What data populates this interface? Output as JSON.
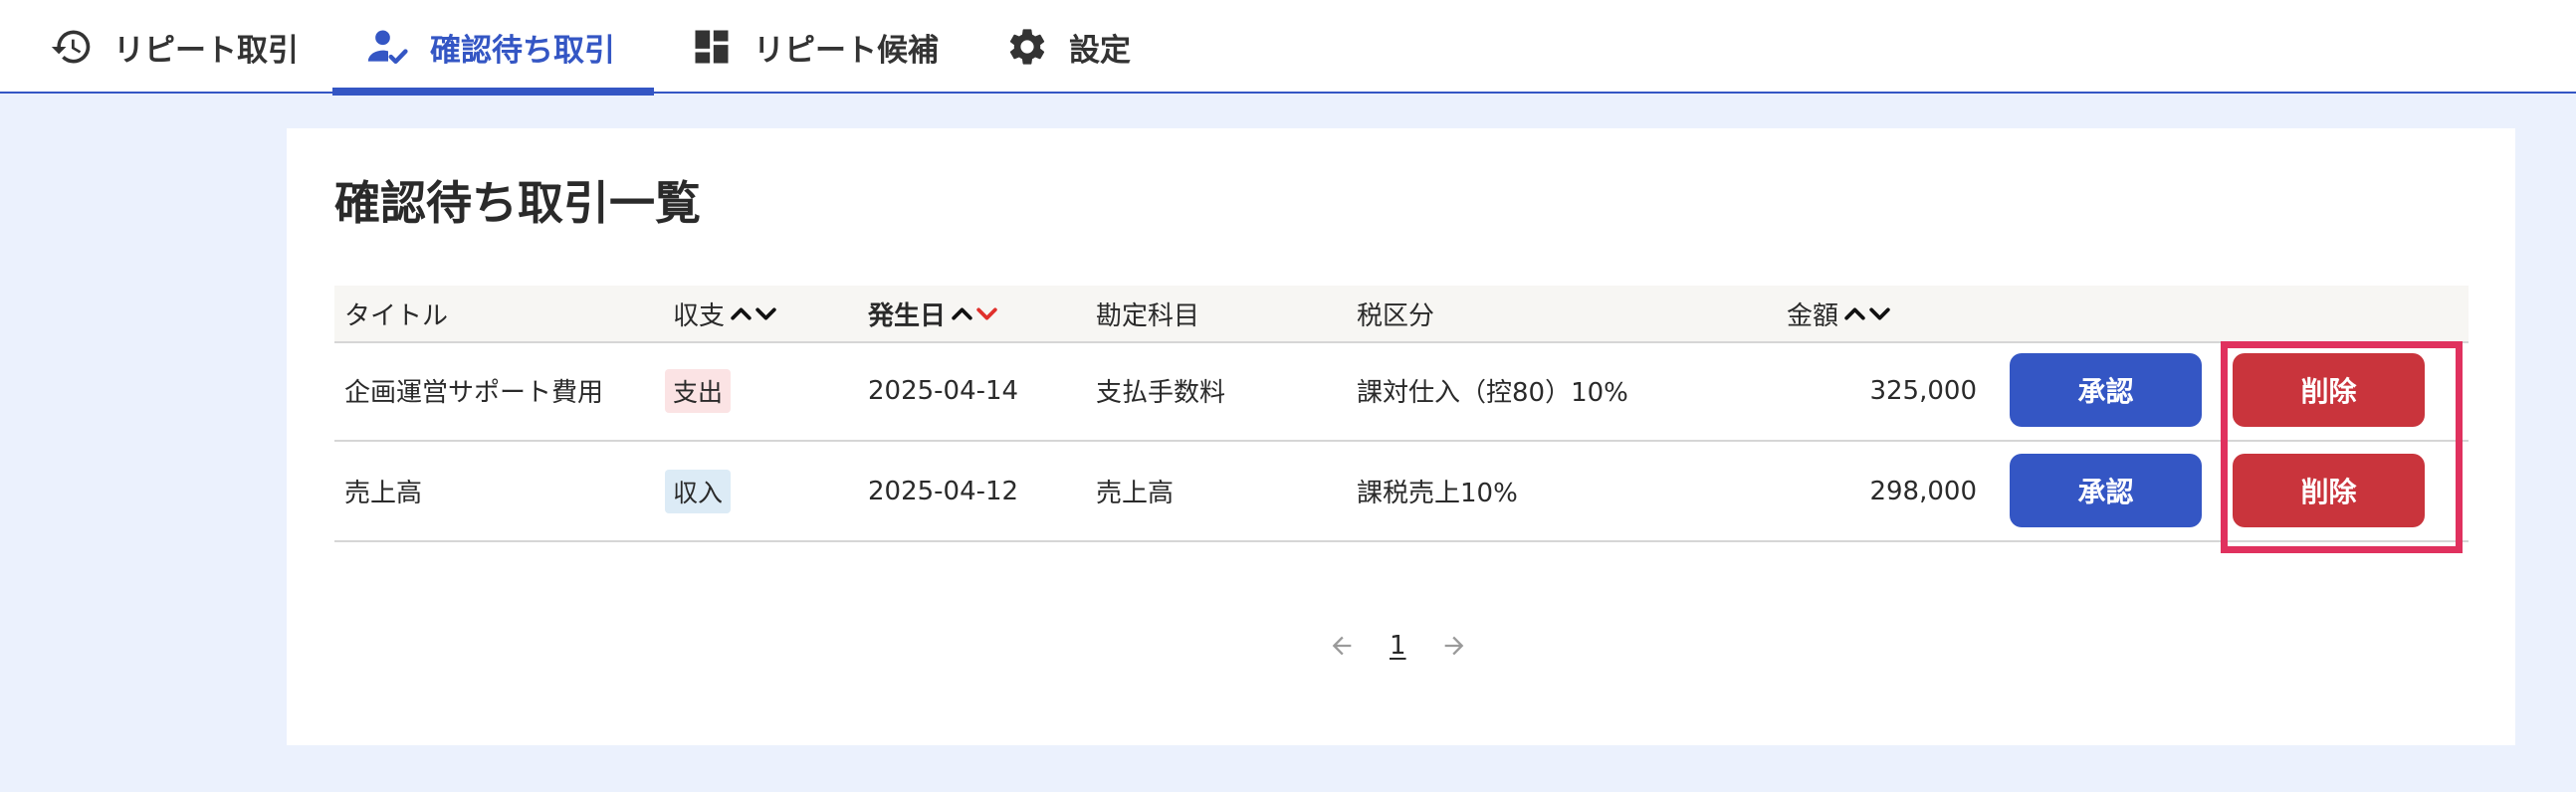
{
  "tabs": [
    {
      "label": "リピート取引",
      "icon": "history-icon",
      "active": false
    },
    {
      "label": "確認待ち取引",
      "icon": "user-check-icon",
      "active": true
    },
    {
      "label": "リピート候補",
      "icon": "dashboard-icon",
      "active": false
    },
    {
      "label": "設定",
      "icon": "gear-icon",
      "active": false
    }
  ],
  "page": {
    "title": "確認待ち取引一覧"
  },
  "table": {
    "headers": {
      "title": "タイトル",
      "type": "収支",
      "date": "発生日",
      "account": "勘定科目",
      "tax": "税区分",
      "amount": "金額"
    },
    "rows": [
      {
        "title": "企画運営サポート費用",
        "type": "支出",
        "type_kind": "expense",
        "date": "2025-04-14",
        "account": "支払手数料",
        "tax": "課対仕入（控80）10%",
        "amount": "325,000",
        "approve_label": "承認",
        "delete_label": "削除"
      },
      {
        "title": "売上高",
        "type": "収入",
        "type_kind": "income",
        "date": "2025-04-12",
        "account": "売上高",
        "tax": "課税売上10%",
        "amount": "298,000",
        "approve_label": "承認",
        "delete_label": "削除"
      }
    ]
  },
  "pagination": {
    "current_page": "1"
  },
  "colors": {
    "accent": "#3456c4",
    "danger": "#c9343c",
    "sort_active": "#e0302b",
    "highlight": "#e0315e",
    "background": "#ebf1fd"
  }
}
